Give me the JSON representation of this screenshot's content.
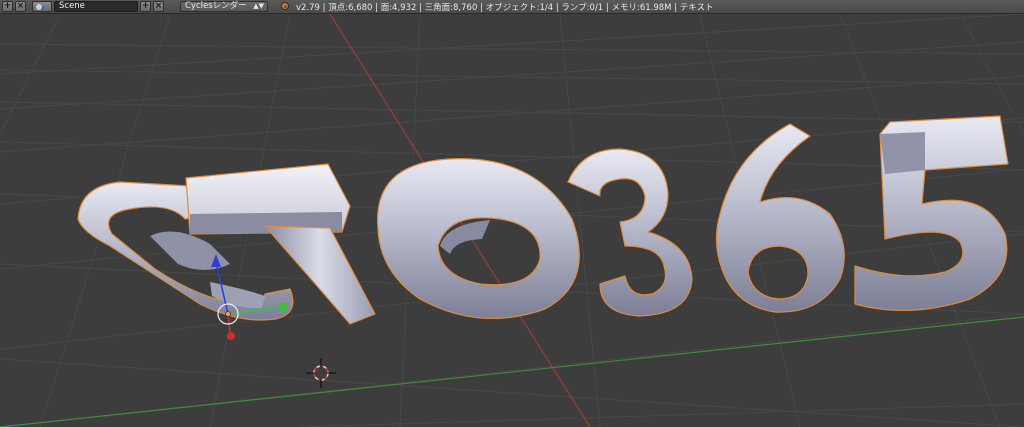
{
  "header": {
    "add_icon": "+",
    "close_icon": "×",
    "scene_name": "Scene",
    "render_engine": "Cyclesレンダー",
    "engine_arrows": "▲▼",
    "stats": "v2.79 | 頂点:6,680 | 面:4,932 | 三角面:8,760 | オブジェクト:1/4 | ランプ:0/1 | メモリ:61.98M | テキスト"
  },
  "viewport": {
    "text_object": "ATO365",
    "colors": {
      "background": "#3d3d3d",
      "grid": "#4a4a4a",
      "x_axis": "#9b3b3b",
      "y_axis": "#3f8a3f",
      "selection_outline": "#e08a3a",
      "mesh": "#b9bccd"
    }
  }
}
